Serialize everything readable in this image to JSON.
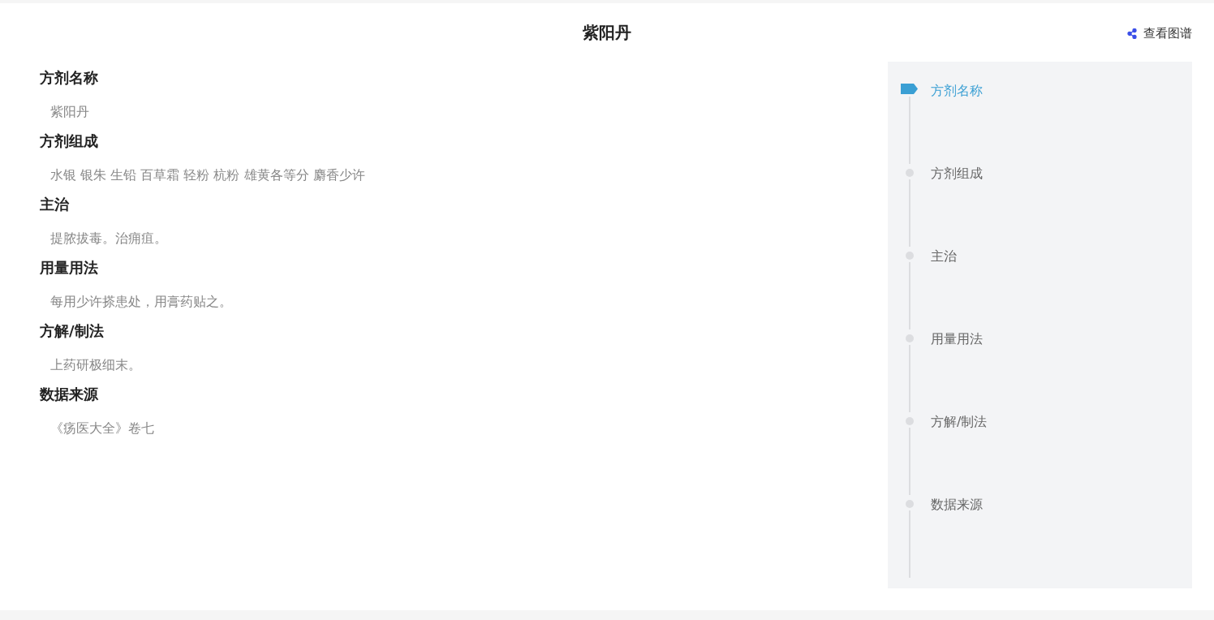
{
  "title": "紫阳丹",
  "graph_link": {
    "label": "查看图谱"
  },
  "sections": [
    {
      "heading": "方剂名称",
      "value": "紫阳丹"
    },
    {
      "heading": "方剂组成",
      "value": "水银 银朱 生铅 百草霜 轻粉 杭粉 雄黄各等分 麝香少许"
    },
    {
      "heading": "主治",
      "value": "提脓拔毒。治痈疽。"
    },
    {
      "heading": "用量用法",
      "value": "每用少许搽患处，用膏药贴之。"
    },
    {
      "heading": "方解/制法",
      "value": "上药研极细末。"
    },
    {
      "heading": "数据来源",
      "value": "《疡医大全》卷七"
    }
  ],
  "toc": [
    {
      "label": "方剂名称",
      "selected": true
    },
    {
      "label": "方剂组成",
      "selected": false
    },
    {
      "label": "主治",
      "selected": false
    },
    {
      "label": "用量用法",
      "selected": false
    },
    {
      "label": "方解/制法",
      "selected": false
    },
    {
      "label": "数据来源",
      "selected": false
    }
  ]
}
